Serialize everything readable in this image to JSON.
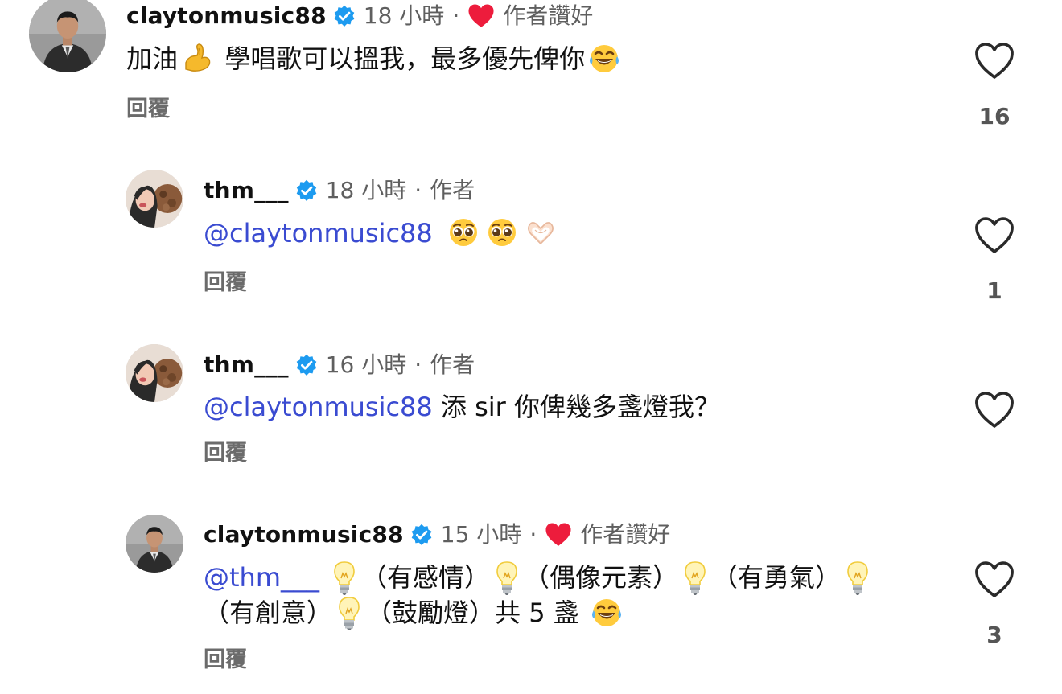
{
  "comments": [
    {
      "username": "claytonmusic88",
      "time": "18 小時",
      "dot": "·",
      "badge": "作者讚好",
      "text_before": "加油",
      "text_main": " 學唱歌可以搵我，最多優先俾你",
      "reply": "回覆",
      "likes": "16"
    },
    {
      "username": "thm___",
      "time": "18 小時",
      "dot": "·",
      "badge": "作者",
      "mention": "@claytonmusic88",
      "reply": "回覆",
      "likes": "1"
    },
    {
      "username": "thm___",
      "time": "16 小時",
      "dot": "·",
      "badge": "作者",
      "mention": "@claytonmusic88",
      "text_main": " 添 sir 你俾幾多盞燈我？",
      "reply": "回覆"
    },
    {
      "username": "claytonmusic88",
      "time": "15 小時",
      "dot": "·",
      "badge": "作者讚好",
      "mention": "@thm___",
      "seg1": "（有感情）",
      "seg2": "（偶像元素）",
      "seg3": "（有勇氣）",
      "seg4": "（有創意）",
      "seg5": "（鼓勵燈）共 5 盞",
      "reply": "回覆",
      "likes": "3"
    }
  ],
  "colors": {
    "mention": "#3a4bd1",
    "verified": "#1d9bf0",
    "heart_red": "#ed1c3c",
    "meta": "#5f5f5f"
  },
  "icons": [
    "verified-badge-icon",
    "heart-icon",
    "flexed-biceps-emoji",
    "laughing-tears-emoji",
    "pleading-face-emoji",
    "heart-hands-emoji",
    "light-bulb-emoji"
  ]
}
